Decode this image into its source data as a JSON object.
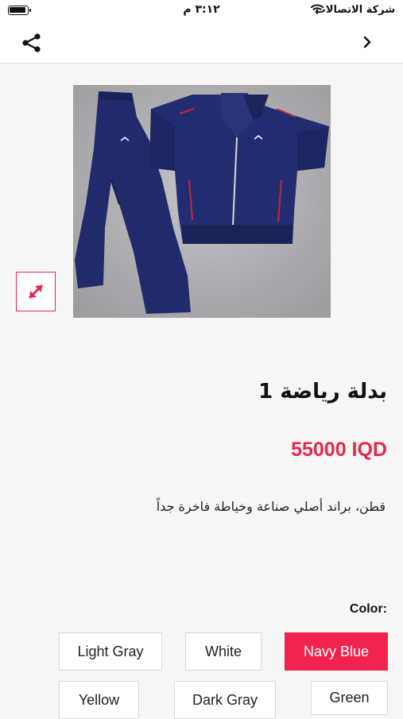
{
  "status_bar": {
    "carrier": "شركة الاتصالات",
    "time": "٣:١٢ م"
  },
  "product": {
    "title": "بدلة رياضة 1",
    "price": "55000 IQD",
    "description": "قطن، براند أصلي صناعة وخياطة فاخرة جداً",
    "image_icon": "tracksuit-image",
    "expand_icon": "expand-arrows-icon"
  },
  "colors": {
    "label": "Color:",
    "selected": "Navy Blue",
    "options": [
      "Light Gray",
      "White",
      "Navy Blue",
      "Yellow",
      "Dark Gray",
      "Green"
    ]
  },
  "theme": {
    "accent": "#f0234e",
    "navy": "#1f2a6b"
  }
}
